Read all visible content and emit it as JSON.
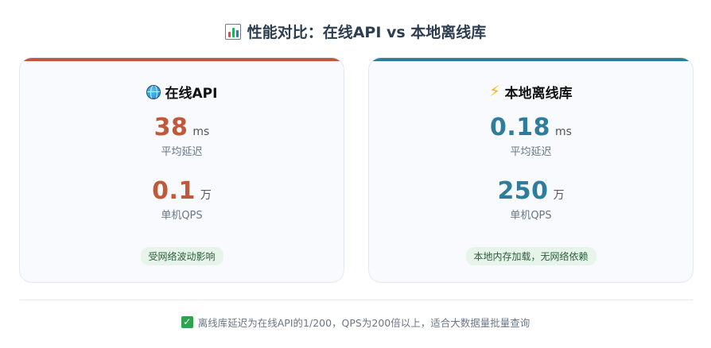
{
  "header": {
    "icon": "bar-chart-icon",
    "title": "性能对比：在线API vs 本地离线库"
  },
  "cards": [
    {
      "icon": "globe-icon",
      "title": "在线API",
      "accent": "#c0583a",
      "latency": {
        "value": "38",
        "unit": "ms",
        "label": "平均延迟"
      },
      "qps": {
        "value": "0.1",
        "unit": "万",
        "label": "单机QPS"
      },
      "note": "受网络波动影响"
    },
    {
      "icon": "lightning-icon",
      "title": "本地离线库",
      "accent": "#2e7d9a",
      "latency": {
        "value": "0.18",
        "unit": "ms",
        "label": "平均延迟"
      },
      "qps": {
        "value": "250",
        "unit": "万",
        "label": "单机QPS"
      },
      "note": "本地内存加载，无网络依赖"
    }
  ],
  "footer": {
    "icon": "check-icon",
    "text": "离线库延迟为在线API的1/200，QPS为200倍以上，适合大数据量批量查询"
  }
}
